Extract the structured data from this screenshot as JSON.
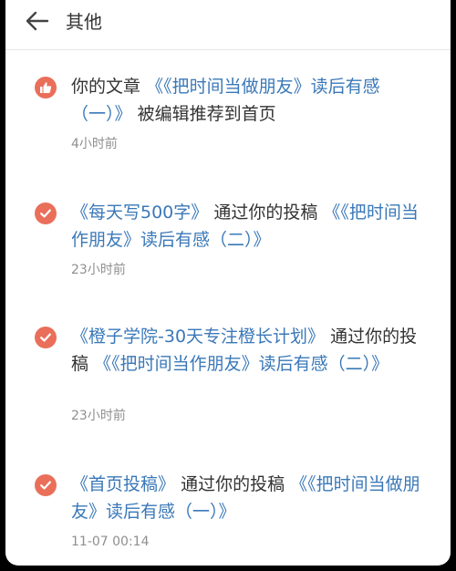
{
  "header": {
    "title": "其他"
  },
  "notices": [
    {
      "icon": "thumbs-up-icon",
      "prefix": "你的文章",
      "article": "《《把时间当做朋友》读后有感（一）》",
      "suffix": "被编辑推荐到首页",
      "time": "4小时前"
    },
    {
      "icon": "check-icon",
      "collection": "《每天写500字》",
      "middle": "通过你的投稿",
      "article": "《《把时间当作朋友》读后有感（二）》",
      "time": "23小时前"
    },
    {
      "icon": "check-icon",
      "collection": "《橙子学院-30天专注橙长计划》",
      "middle": "通过你的投稿",
      "article": "《《把时间当作朋友》读后有感（二）》",
      "time": "23小时前"
    },
    {
      "icon": "check-icon",
      "collection": "《首页投稿》",
      "middle": "通过你的投稿",
      "article": "《《把时间当做朋友》读后有感（一）》",
      "time": "11-07 00:14"
    }
  ],
  "colors": {
    "accent": "#ea6f5a",
    "link": "#3a78b8",
    "text": "#333333",
    "muted": "#8f8f8f"
  }
}
